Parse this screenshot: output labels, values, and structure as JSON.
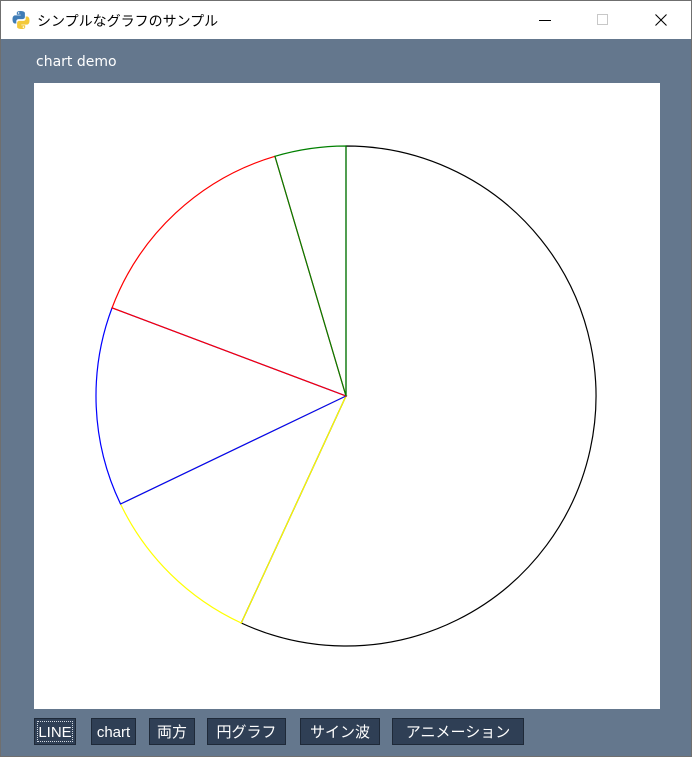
{
  "window": {
    "title": "シンプルなグラフのサンプル"
  },
  "frame": {
    "label": "chart demo"
  },
  "buttons": [
    {
      "label": "LINE"
    },
    {
      "label": "chart"
    },
    {
      "label": "両方"
    },
    {
      "label": "円グラフ"
    },
    {
      "label": "サイン波"
    },
    {
      "label": "アニメーション"
    }
  ],
  "colors": {
    "background": "#64778d",
    "canvas": "#ffffff",
    "button": "#2f3f55"
  },
  "chart_data": {
    "type": "pie",
    "values": [
      62,
      12,
      14,
      16,
      5
    ],
    "colors": [
      "#000000",
      "#ffff00",
      "#0000ff",
      "#ff0000",
      "#008000"
    ],
    "start_angle_deg": 90,
    "direction": "clockwise"
  }
}
